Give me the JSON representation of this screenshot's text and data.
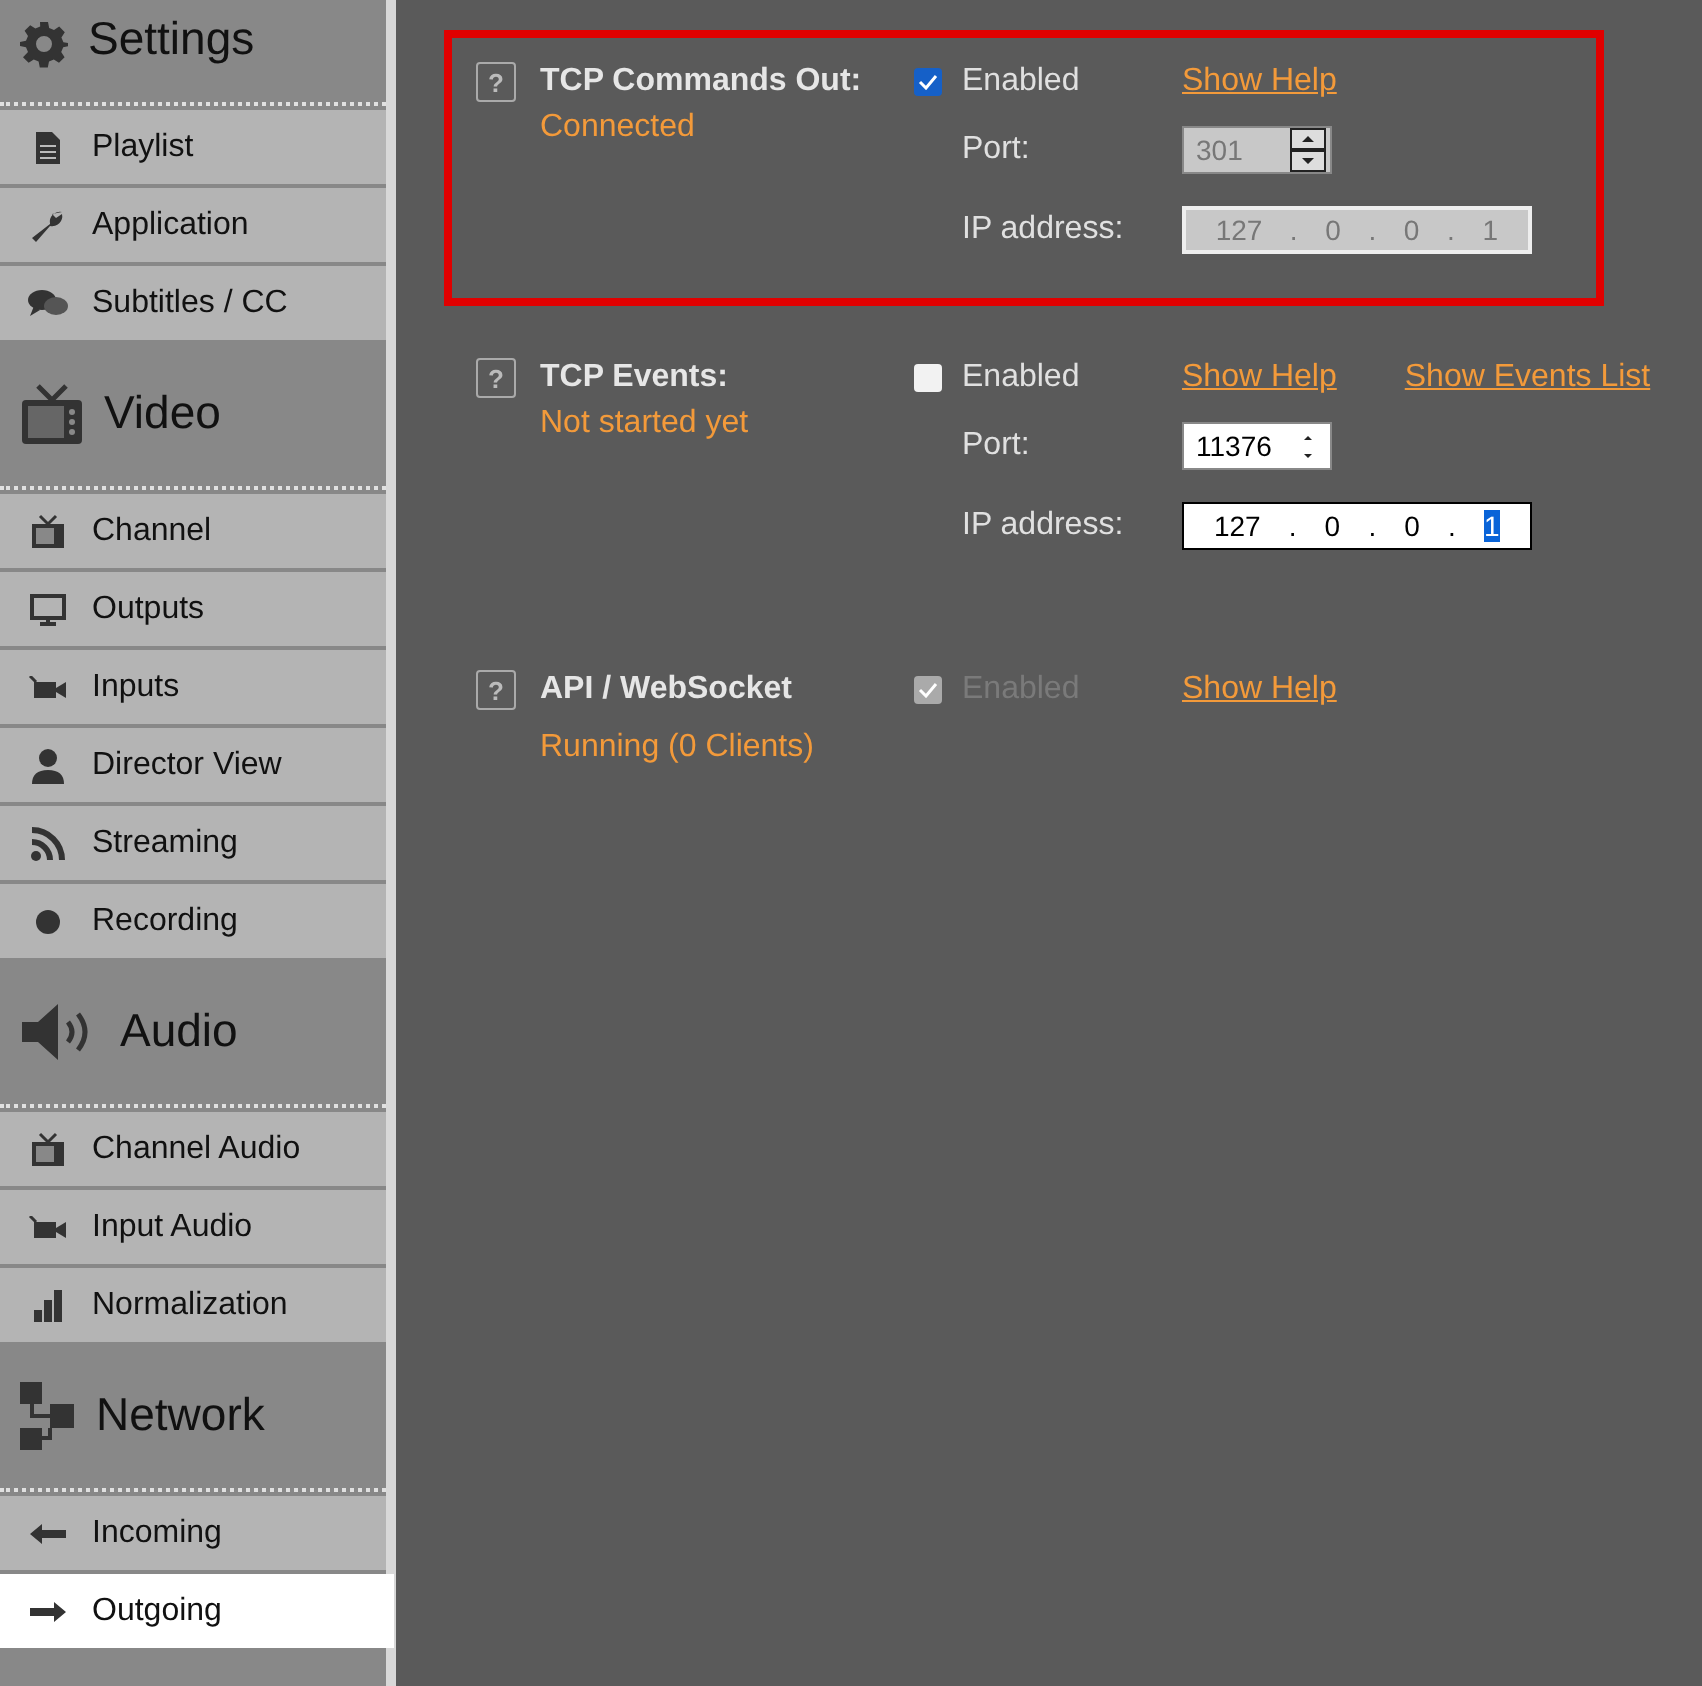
{
  "sidebar": {
    "sections": [
      {
        "title": "Settings",
        "items": [
          {
            "label": "Playlist",
            "selected": false
          },
          {
            "label": "Application",
            "selected": false
          },
          {
            "label": "Subtitles / CC",
            "selected": false
          }
        ]
      },
      {
        "title": "Video",
        "items": [
          {
            "label": "Channel",
            "selected": false
          },
          {
            "label": "Outputs",
            "selected": false
          },
          {
            "label": "Inputs",
            "selected": false
          },
          {
            "label": "Director View",
            "selected": false
          },
          {
            "label": "Streaming",
            "selected": false
          },
          {
            "label": "Recording",
            "selected": false
          }
        ]
      },
      {
        "title": "Audio",
        "items": [
          {
            "label": "Channel Audio",
            "selected": false
          },
          {
            "label": "Input Audio",
            "selected": false
          },
          {
            "label": "Normalization",
            "selected": false
          }
        ]
      },
      {
        "title": "Network",
        "items": [
          {
            "label": "Incoming",
            "selected": false
          },
          {
            "label": "Outgoing",
            "selected": true
          }
        ]
      }
    ]
  },
  "services": [
    {
      "help": "?",
      "title": "TCP Commands Out:",
      "status": "Connected",
      "highlighted": true,
      "enabled": {
        "label": "Enabled",
        "checked": true,
        "disabled": false
      },
      "links": [
        "Show Help"
      ],
      "port": {
        "label": "Port:",
        "value": "301",
        "disabled": true
      },
      "ip": {
        "label": "IP address:",
        "separator": ".",
        "disabled": true,
        "octets": [
          {
            "text": "127",
            "selected": false
          },
          {
            "text": "0",
            "selected": false
          },
          {
            "text": "0",
            "selected": false
          },
          {
            "text": "1",
            "selected": false
          }
        ]
      }
    },
    {
      "help": "?",
      "title": "TCP Events:",
      "status": "Not started yet",
      "highlighted": false,
      "enabled": {
        "label": "Enabled",
        "checked": false,
        "disabled": false
      },
      "links": [
        "Show Help",
        "Show Events List"
      ],
      "port": {
        "label": "Port:",
        "value": "11376",
        "disabled": false
      },
      "ip": {
        "label": "IP address:",
        "separator": ".",
        "disabled": false,
        "octets": [
          {
            "text": "127",
            "selected": false
          },
          {
            "text": "0",
            "selected": false
          },
          {
            "text": "0",
            "selected": false
          },
          {
            "text": "1",
            "selected": true
          }
        ]
      }
    },
    {
      "help": "?",
      "title": "API / WebSocket",
      "status": "Running (0 Clients)",
      "highlighted": false,
      "enabled": {
        "label": "Enabled",
        "checked": true,
        "disabled": true
      },
      "links": [
        "Show Help"
      ]
    }
  ]
}
